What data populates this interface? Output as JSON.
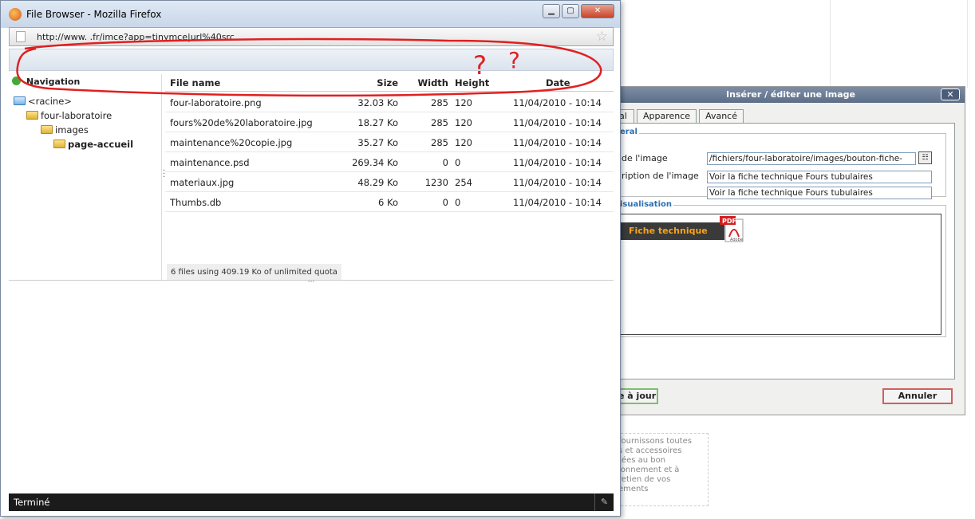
{
  "background_text": "fournissons toutes\ns et accessoires\ntées au bon\nionnement et à\nretien de vos\nements",
  "image_dialog": {
    "title": "Insérer / éditer une image",
    "close": "✕",
    "tabs": [
      "al",
      "Apparence",
      "Avancé"
    ],
    "legend_general": "eral",
    "label_url": "de l'image",
    "value_url": "/fichiers/four-laboratoire/images/bouton-fiche-",
    "label_desc": "ription de l'image",
    "value_desc": "Voir la fiche technique Fours tubulaires",
    "value_title": "Voir la fiche technique Fours tubulaires",
    "legend_preview": "isualisation",
    "preview_text": "Fiche technique",
    "pdf_label": "PDF",
    "adobe_label": "Adobe",
    "btn_update": "e à jour",
    "btn_cancel": "Annuler"
  },
  "firefox": {
    "title": "File Browser - Mozilla Firefox",
    "url": "http://www.        .fr/imce?app=tinymce|url%40src",
    "status": "Terminé"
  },
  "navigation": {
    "heading": "Navigation",
    "items": [
      "<racine>",
      "four-laboratoire",
      "images",
      "page-accueil"
    ]
  },
  "files": {
    "headers": {
      "name": "File name",
      "size": "Size",
      "width": "Width",
      "height": "Height",
      "date": "Date"
    },
    "rows": [
      {
        "name": "four-laboratoire.png",
        "size": "32.03 Ko",
        "width": "285",
        "height": "120",
        "date": "11/04/2010 - 10:14"
      },
      {
        "name": "fours%20de%20laboratoire.jpg",
        "size": "18.27 Ko",
        "width": "285",
        "height": "120",
        "date": "11/04/2010 - 10:14"
      },
      {
        "name": "maintenance%20copie.jpg",
        "size": "35.27 Ko",
        "width": "285",
        "height": "120",
        "date": "11/04/2010 - 10:14"
      },
      {
        "name": "maintenance.psd",
        "size": "269.34 Ko",
        "width": "0",
        "height": "0",
        "date": "11/04/2010 - 10:14"
      },
      {
        "name": "materiaux.jpg",
        "size": "48.29 Ko",
        "width": "1230",
        "height": "254",
        "date": "11/04/2010 - 10:14"
      },
      {
        "name": "Thumbs.db",
        "size": "6 Ko",
        "width": "0",
        "height": "0",
        "date": "11/04/2010 - 10:14"
      }
    ],
    "quota": "6 files using 409.19 Ko of unlimited quota"
  },
  "annotation": {
    "color": "#e02020",
    "marks": [
      "?",
      "?"
    ]
  }
}
